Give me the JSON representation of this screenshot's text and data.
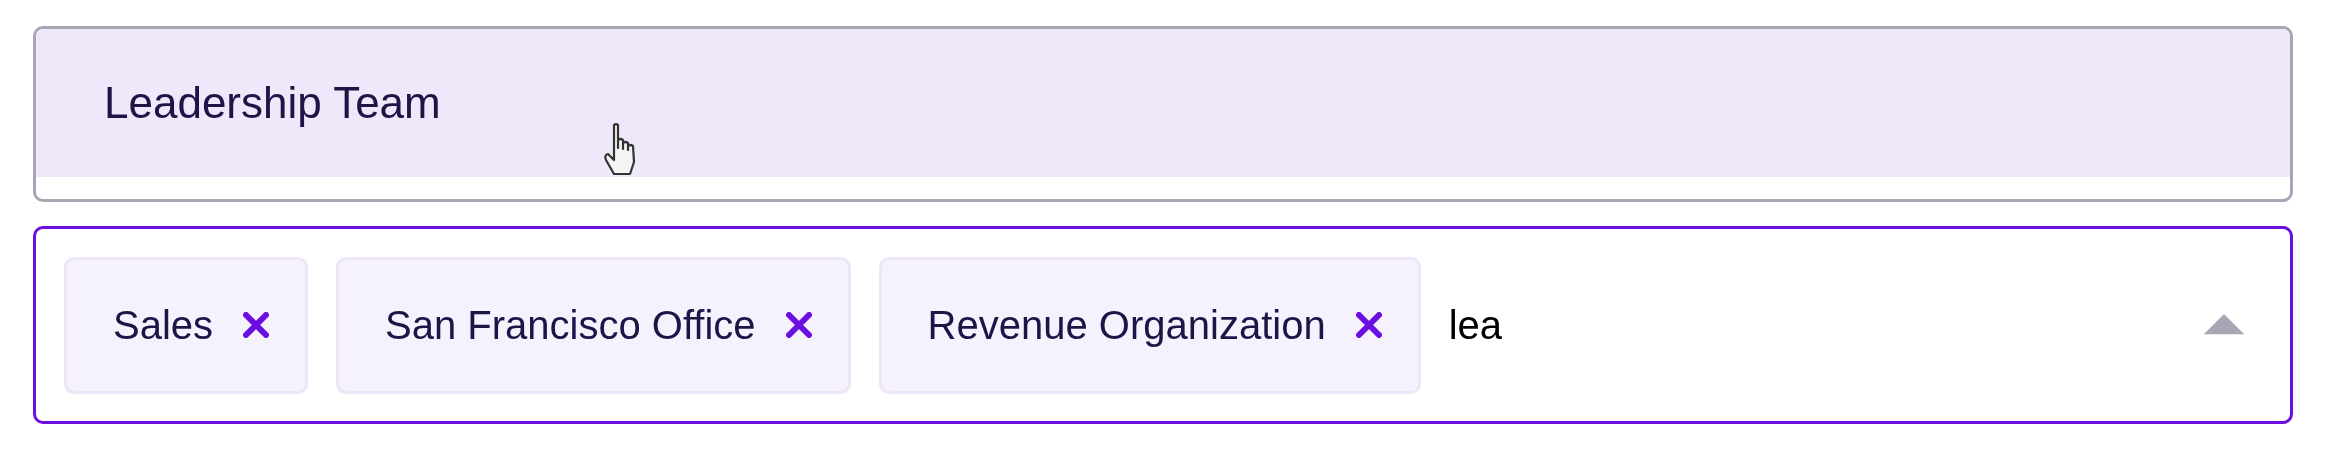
{
  "options": [
    {
      "label": "Leadership Team",
      "highlighted": true
    }
  ],
  "selector": {
    "chips": [
      {
        "label": "Sales"
      },
      {
        "label": "San Francisco Office"
      },
      {
        "label": "Revenue Organization"
      }
    ],
    "value": "lea",
    "expanded": true
  }
}
